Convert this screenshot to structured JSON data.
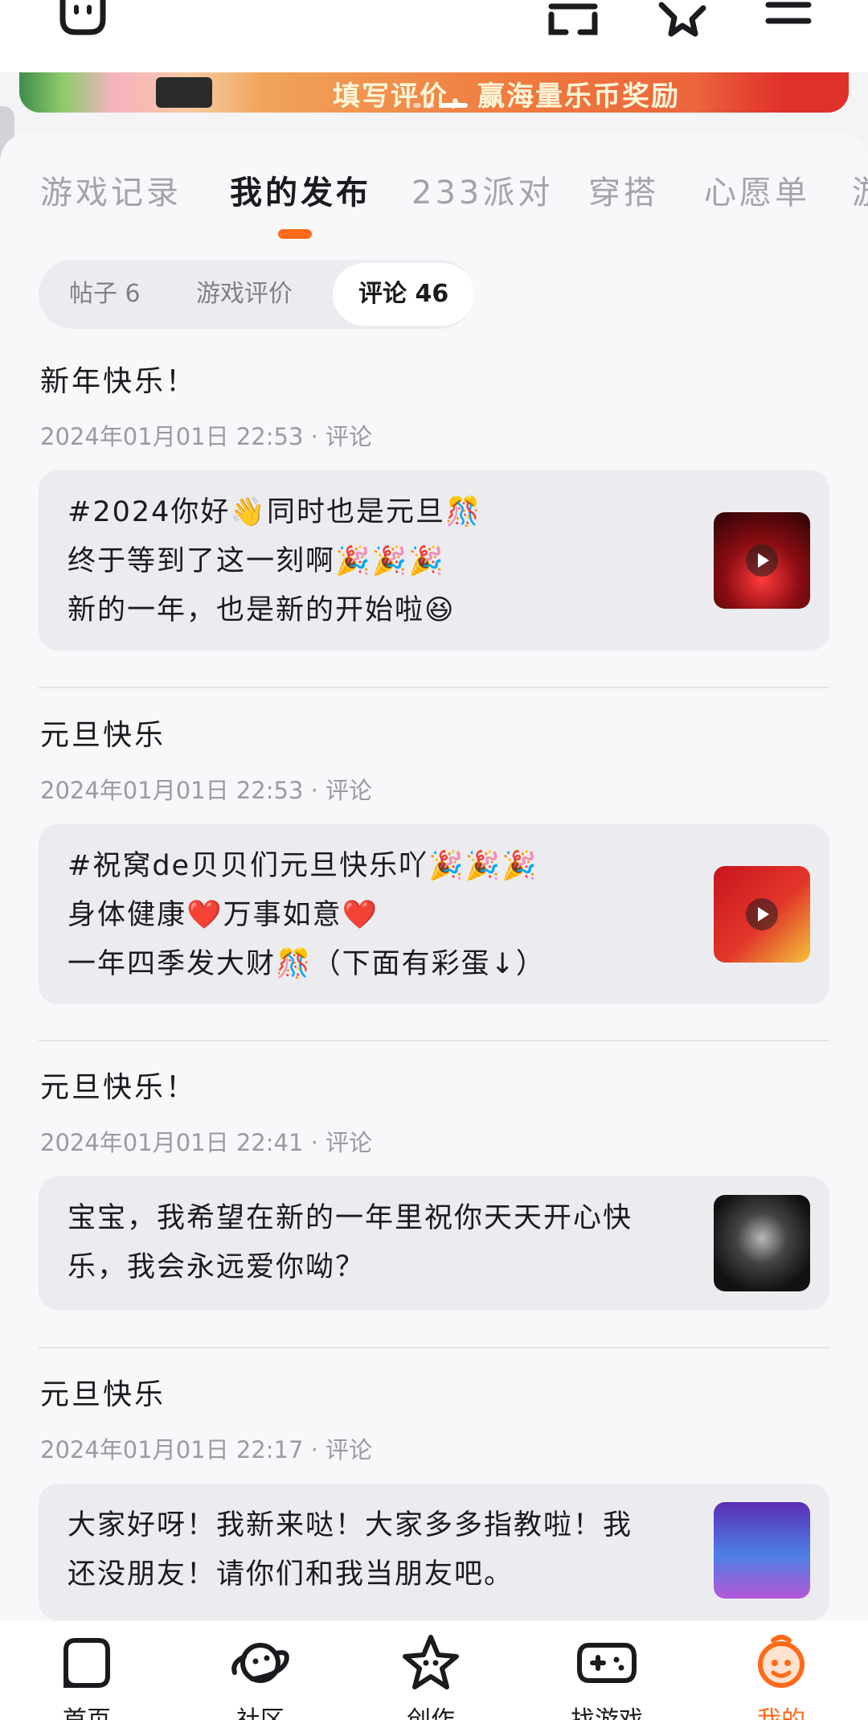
{
  "banner": {
    "text": "填写评价，赢海量乐币奖励"
  },
  "tabs": [
    {
      "label": "游戏记录"
    },
    {
      "label": "我的发布"
    },
    {
      "label": "233派对"
    },
    {
      "label": "穿搭"
    },
    {
      "label": "心愿单"
    },
    {
      "label": "游"
    }
  ],
  "subtabs": [
    {
      "label": "帖子 6"
    },
    {
      "label": "游戏评价"
    },
    {
      "label": "评论 46"
    }
  ],
  "comments": [
    {
      "title": "新年快乐！",
      "meta": "2024年01月01日 22:53 · 评论",
      "text": "#2024你好👋同时也是元旦🎊\n终于等到了这一刻啊🎉🎉🎉\n新的一年，也是新的开始啦😆",
      "thumb_icon": "fireworks-video-thumbnail"
    },
    {
      "title": "元旦快乐",
      "meta": "2024年01月01日 22:53 · 评论",
      "text": "#祝窝de贝贝们元旦快乐吖🎉🎉🎉\n身体健康❤️万事如意❤️\n一年四季发大财🎊（下面有彩蛋↓）",
      "thumb_icon": "new-year-dragon-video-thumbnail"
    },
    {
      "title": "元旦快乐！",
      "meta": "2024年01月01日 22:41 · 评论",
      "text": "宝宝，我希望在新的一年里祝你天天开心快\n乐，我会永远爱你呦？",
      "thumb_icon": "heart-hand-thumbnail"
    },
    {
      "title": "元旦快乐",
      "meta": "2024年01月01日 22:17 · 评论",
      "text": "大家好呀！我新来哒！大家多多指教啦！我\n还没朋友！请你们和我当朋友吧。",
      "thumb_icon": "avatar-girl-thumbnail"
    }
  ],
  "bottom_nav": [
    {
      "label": "首页",
      "icon": "home-icon"
    },
    {
      "label": "社区",
      "icon": "planet-icon"
    },
    {
      "label": "创作",
      "icon": "star-create-icon"
    },
    {
      "label": "找游戏",
      "icon": "gamepad-icon"
    },
    {
      "label": "我的",
      "icon": "profile-icon"
    }
  ],
  "colors": {
    "accent": "#ff6a1a",
    "background": "#f4f4f7",
    "card_bg": "#ececf0",
    "meta_text": "#9a9aa3"
  }
}
